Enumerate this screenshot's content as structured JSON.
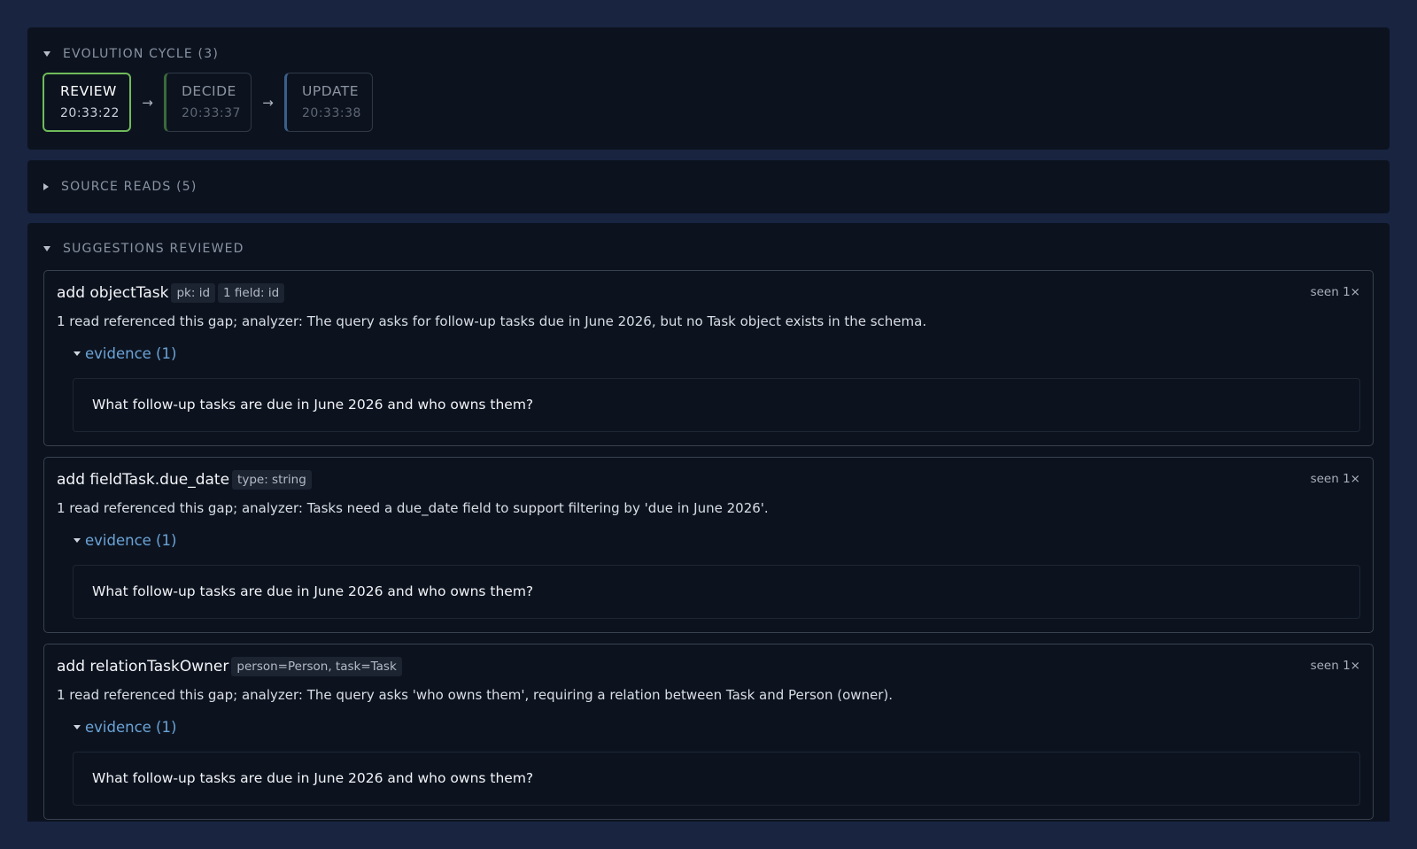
{
  "evolution": {
    "header": "EVOLUTION CYCLE (3)",
    "stages": [
      {
        "name": "REVIEW",
        "time": "20:33:22"
      },
      {
        "name": "DECIDE",
        "time": "20:33:37"
      },
      {
        "name": "UPDATE",
        "time": "20:33:38"
      }
    ],
    "arrow": "→"
  },
  "source_reads": {
    "header": "SOURCE READS (5)"
  },
  "suggestions": {
    "header": "SUGGESTIONS REVIEWED",
    "items": [
      {
        "title": "add objectTask",
        "tags": [
          "pk: id",
          "1 field: id"
        ],
        "seen": "seen 1×",
        "description": "1 read referenced this gap; analyzer: The query asks for follow-up tasks due in June 2026, but no Task object exists in the schema.",
        "evidence_label": "evidence (1)",
        "evidence": "What follow-up tasks are due in June 2026 and who owns them?"
      },
      {
        "title": "add fieldTask.due_date",
        "tags": [
          "type: string"
        ],
        "seen": "seen 1×",
        "description": "1 read referenced this gap; analyzer: Tasks need a due_date field to support filtering by 'due in June 2026'.",
        "evidence_label": "evidence (1)",
        "evidence": "What follow-up tasks are due in June 2026 and who owns them?"
      },
      {
        "title": "add relationTaskOwner",
        "tags": [
          "person=Person, task=Task"
        ],
        "seen": "seen 1×",
        "description": "1 read referenced this gap; analyzer: The query asks 'who owns them', requiring a relation between Task and Person (owner).",
        "evidence_label": "evidence (1)",
        "evidence": "What follow-up tasks are due in June 2026 and who owns them?"
      }
    ]
  }
}
